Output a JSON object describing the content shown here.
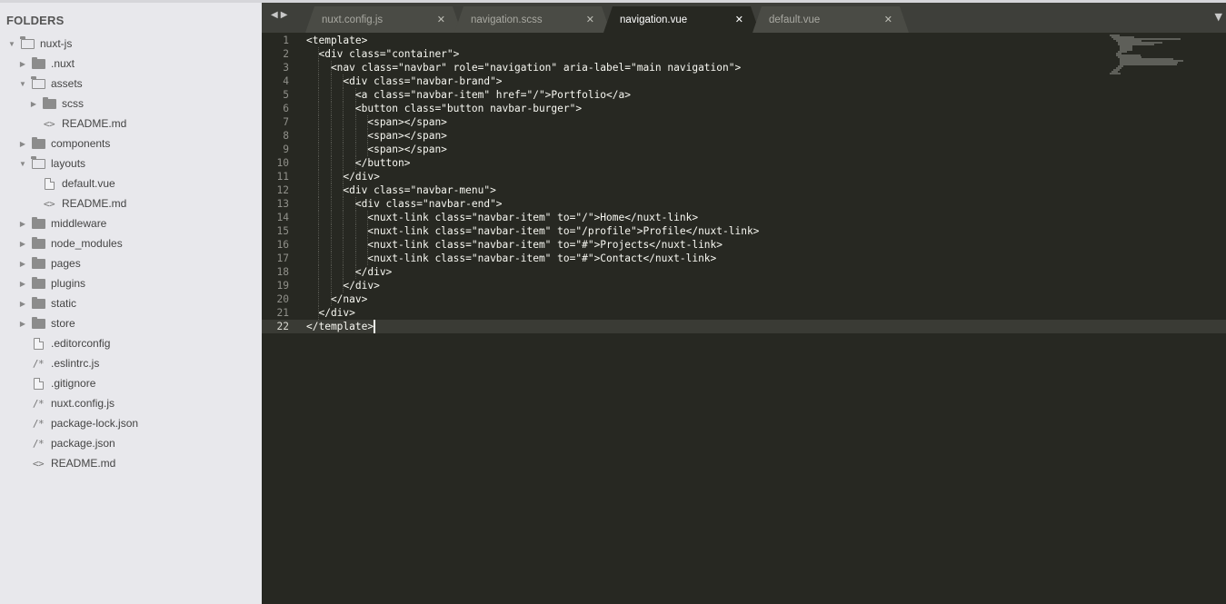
{
  "sidebar": {
    "title": "FOLDERS",
    "tree": [
      {
        "label": "nuxt-js",
        "type": "folder-open",
        "depth": 0,
        "expandable": true,
        "expanded": true
      },
      {
        "label": ".nuxt",
        "type": "folder",
        "depth": 1,
        "expandable": true,
        "expanded": false
      },
      {
        "label": "assets",
        "type": "folder-open",
        "depth": 1,
        "expandable": true,
        "expanded": true
      },
      {
        "label": "scss",
        "type": "folder",
        "depth": 2,
        "expandable": true,
        "expanded": false
      },
      {
        "label": "README.md",
        "type": "code-file",
        "depth": 2,
        "expandable": false
      },
      {
        "label": "components",
        "type": "folder",
        "depth": 1,
        "expandable": true,
        "expanded": false
      },
      {
        "label": "layouts",
        "type": "folder-open",
        "depth": 1,
        "expandable": true,
        "expanded": true
      },
      {
        "label": "default.vue",
        "type": "file",
        "depth": 2,
        "expandable": false
      },
      {
        "label": "README.md",
        "type": "code-file",
        "depth": 2,
        "expandable": false
      },
      {
        "label": "middleware",
        "type": "folder",
        "depth": 1,
        "expandable": true,
        "expanded": false
      },
      {
        "label": "node_modules",
        "type": "folder",
        "depth": 1,
        "expandable": true,
        "expanded": false
      },
      {
        "label": "pages",
        "type": "folder",
        "depth": 1,
        "expandable": true,
        "expanded": false
      },
      {
        "label": "plugins",
        "type": "folder",
        "depth": 1,
        "expandable": true,
        "expanded": false
      },
      {
        "label": "static",
        "type": "folder",
        "depth": 1,
        "expandable": true,
        "expanded": false
      },
      {
        "label": "store",
        "type": "folder",
        "depth": 1,
        "expandable": true,
        "expanded": false
      },
      {
        "label": ".editorconfig",
        "type": "file",
        "depth": 1,
        "expandable": false
      },
      {
        "label": ".eslintrc.js",
        "type": "comment-file",
        "depth": 1,
        "expandable": false
      },
      {
        "label": ".gitignore",
        "type": "file",
        "depth": 1,
        "expandable": false
      },
      {
        "label": "nuxt.config.js",
        "type": "comment-file",
        "depth": 1,
        "expandable": false
      },
      {
        "label": "package-lock.json",
        "type": "comment-file",
        "depth": 1,
        "expandable": false
      },
      {
        "label": "package.json",
        "type": "comment-file",
        "depth": 1,
        "expandable": false
      },
      {
        "label": "README.md",
        "type": "code-file",
        "depth": 1,
        "expandable": false
      }
    ]
  },
  "tabs": [
    {
      "label": "nuxt.config.js",
      "active": false
    },
    {
      "label": "navigation.scss",
      "active": false
    },
    {
      "label": "navigation.vue",
      "active": true
    },
    {
      "label": "default.vue",
      "active": false
    }
  ],
  "tab_close_glyph": "✕",
  "editor": {
    "current_line": 22,
    "lines": [
      "<template>",
      "  <div class=\"container\">",
      "    <nav class=\"navbar\" role=\"navigation\" aria-label=\"main navigation\">",
      "      <div class=\"navbar-brand\">",
      "        <a class=\"navbar-item\" href=\"/\">Portfolio</a>",
      "        <button class=\"button navbar-burger\">",
      "          <span></span>",
      "          <span></span>",
      "          <span></span>",
      "        </button>",
      "      </div>",
      "      <div class=\"navbar-menu\">",
      "        <div class=\"navbar-end\">",
      "          <nuxt-link class=\"navbar-item\" to=\"/\">Home</nuxt-link>",
      "          <nuxt-link class=\"navbar-item\" to=\"/profile\">Profile</nuxt-link>",
      "          <nuxt-link class=\"navbar-item\" to=\"#\">Projects</nuxt-link>",
      "          <nuxt-link class=\"navbar-item\" to=\"#\">Contact</nuxt-link>",
      "        </div>",
      "      </div>",
      "    </nav>",
      "  </div>",
      "</template>"
    ]
  },
  "colors": {
    "editor_bg": "#272822",
    "sidebar_bg": "#e8e8ec",
    "tabbar_bg": "#3e3f3a",
    "text": "#f8f8f2"
  }
}
